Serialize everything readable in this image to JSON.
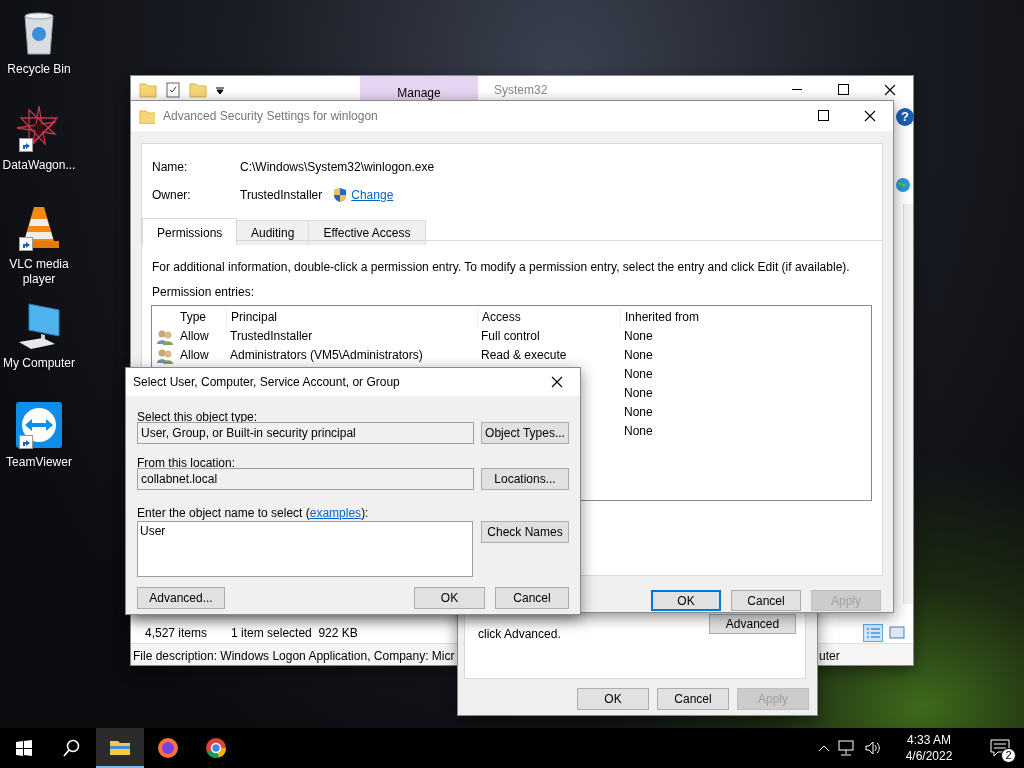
{
  "desktop_icons": [
    {
      "label": "Recycle Bin",
      "kind": "bin",
      "shortcut": false
    },
    {
      "label": "DataWagon...",
      "kind": "star",
      "shortcut": true
    },
    {
      "label": "VLC media player",
      "kind": "cone",
      "shortcut": true
    },
    {
      "label": "My Computer",
      "kind": "computer",
      "shortcut": false
    },
    {
      "label": "TeamViewer",
      "kind": "teamviewer",
      "shortcut": true
    }
  ],
  "explorer": {
    "ribbon_tab": "Manage",
    "title": "System32",
    "help_glyph": "?",
    "status": {
      "items": "4,527 items",
      "selection": "1 item selected  922 KB"
    },
    "details": "File description: Windows Logon Application, Company: Micr",
    "details_tail": "uter"
  },
  "properties_dialog": {
    "note": "click Advanced.",
    "advanced_button": "Advanced",
    "buttons": [
      {
        "label": "OK",
        "disabled": false
      },
      {
        "label": "Cancel",
        "disabled": false
      },
      {
        "label": "Apply",
        "disabled": true
      }
    ]
  },
  "advanced_security": {
    "title": "Advanced Security Settings for winlogon",
    "fields": [
      {
        "label": "Name:",
        "value": "C:\\Windows\\System32\\winlogon.exe"
      },
      {
        "label": "Owner:",
        "value": "TrustedInstaller",
        "link": "Change"
      }
    ],
    "tabs": [
      {
        "label": "Permissions",
        "selected": true
      },
      {
        "label": "Auditing",
        "selected": false
      },
      {
        "label": "Effective Access",
        "selected": false
      }
    ],
    "info": "For additional information, double-click a permission entry. To modify a permission entry, select the entry and click Edit (if available).",
    "entries_label": "Permission entries:",
    "table": {
      "columns": [
        "Type",
        "Principal",
        "Access",
        "Inherited from"
      ],
      "rows": [
        {
          "type": "Allow",
          "principal": "TrustedInstaller",
          "access": "Full control",
          "inherited": "None"
        },
        {
          "type": "Allow",
          "principal": "Administrators (VM5\\Administrators)",
          "access": "Read & execute",
          "inherited": "None"
        },
        {
          "inherited": "None"
        },
        {
          "inherited": "None"
        },
        {
          "inherited": "None"
        },
        {
          "inherited": "None"
        }
      ]
    },
    "buttons": [
      {
        "label": "OK",
        "default": true,
        "disabled": false
      },
      {
        "label": "Cancel",
        "default": false,
        "disabled": false
      },
      {
        "label": "Apply",
        "default": false,
        "disabled": true
      }
    ]
  },
  "select_dialog": {
    "title": "Select User, Computer, Service Account, or Group",
    "object_type": {
      "label": "Select this object type:",
      "value": "User, Group, or Built-in security principal",
      "button": "Object Types..."
    },
    "location": {
      "label": "From this location:",
      "value": "collabnet.local",
      "button": "Locations..."
    },
    "name_entry": {
      "label_before": "Enter the object name to select (",
      "link": "examples",
      "label_after": "):",
      "value": "User",
      "button": "Check Names"
    },
    "buttons": [
      "Advanced...",
      "OK",
      "Cancel"
    ]
  },
  "taskbar": {
    "apps": [
      {
        "kind": "explorer",
        "active": true
      },
      {
        "kind": "firefox",
        "active": false
      },
      {
        "kind": "chrome",
        "active": false
      }
    ],
    "time": "4:33 AM",
    "date": "4/6/2022",
    "notifications": "2"
  }
}
